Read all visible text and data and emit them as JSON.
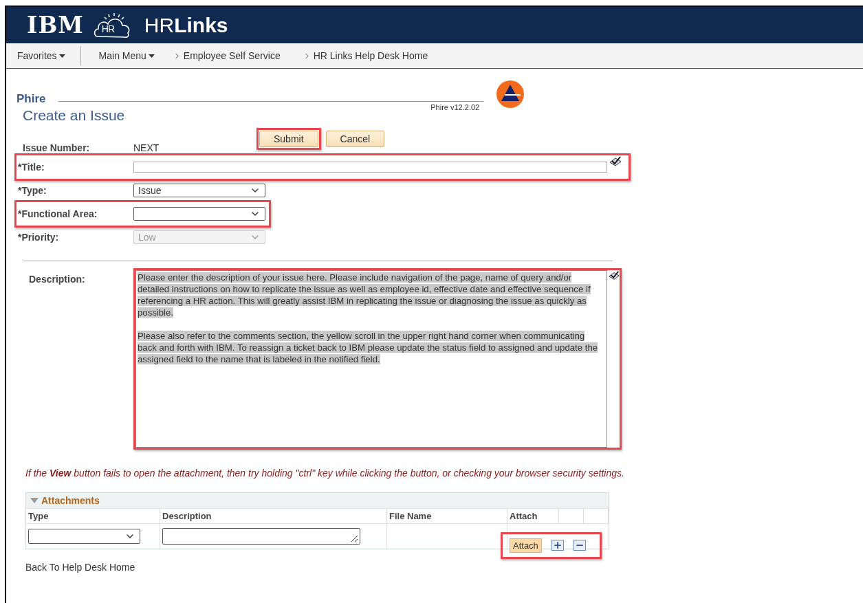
{
  "header": {
    "logo": "IBM",
    "cloud_badge": "HR",
    "app_name_regular": "HR",
    "app_name_bold": "Links"
  },
  "nav": [
    {
      "label": "Favorites",
      "kind": "menu"
    },
    {
      "label": "Main Menu",
      "kind": "menu"
    },
    {
      "label": "Employee Self Service",
      "kind": "crumb"
    },
    {
      "label": "HR Links Help Desk Home",
      "kind": "crumb"
    }
  ],
  "section_title": "Phire",
  "page_title": "Create an Issue",
  "version": "Phire v12.2.02",
  "buttons": [
    {
      "label": "Submit",
      "highlighted": true
    },
    {
      "label": "Cancel",
      "highlighted": false
    }
  ],
  "issue_number": {
    "label": "Issue Number:",
    "value": "NEXT"
  },
  "fields": [
    {
      "kind": "text",
      "label": "*Title:",
      "highlighted": true,
      "disabled": false
    },
    {
      "kind": "select",
      "label": "*Type:",
      "value": "Issue",
      "highlighted": false,
      "disabled": false
    },
    {
      "kind": "select",
      "label": "*Functional Area:",
      "highlighted": true,
      "disabled": false
    },
    {
      "kind": "select",
      "label": "*Priority:",
      "value": "Low",
      "highlighted": false,
      "disabled": true
    }
  ],
  "description": {
    "label": "Description:",
    "highlighted": true,
    "text_selected": true,
    "paragraphs": [
      "Please enter the description of your issue here. Please include navigation of the page, name of query and/or detailed instructions on how to replicate the issue as well as employee id, effective date and effective sequence if referencing a HR action. This will greatly assist IBM in replicating the issue or diagnosing the issue as quickly as possible.",
      "Please also refer to the comments section, the yellow scroll in the upper right hand corner when communicating back and forth with IBM. To reassign a ticket back to IBM please update the status field to assigned and update the assigned field to the name that is labeled in the notified field."
    ]
  },
  "notice": "If the **View** button fails to open the attachment, then try holding \"ctrl\" key while clicking the button, or checking your browser security settings.",
  "attachments": {
    "title": "Attachments",
    "expanded": true,
    "columns": [
      "Type",
      "Description",
      "File Name",
      "Attach"
    ],
    "attach_button": "Attach",
    "highlighted": true
  },
  "back_link": "Back To Help Desk Home"
}
